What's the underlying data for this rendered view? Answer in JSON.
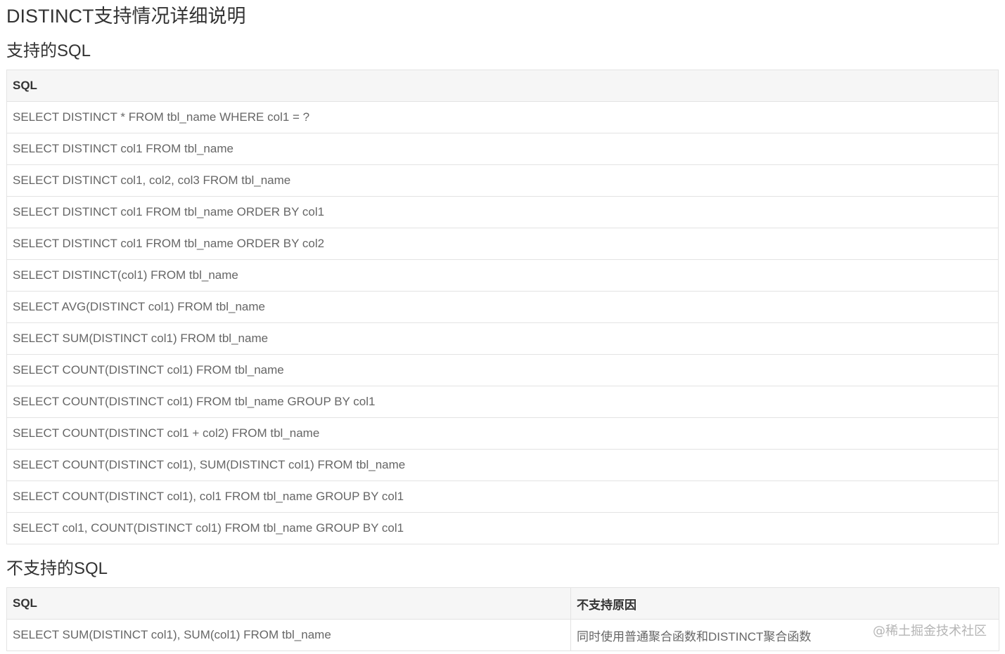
{
  "page": {
    "title": "DISTINCT支持情况详细说明"
  },
  "supported": {
    "heading": "支持的SQL",
    "column_header": "SQL",
    "rows": [
      "SELECT DISTINCT * FROM tbl_name WHERE col1 = ?",
      "SELECT DISTINCT col1 FROM tbl_name",
      "SELECT DISTINCT col1, col2, col3 FROM tbl_name",
      "SELECT DISTINCT col1 FROM tbl_name ORDER BY col1",
      "SELECT DISTINCT col1 FROM tbl_name ORDER BY col2",
      "SELECT DISTINCT(col1) FROM tbl_name",
      "SELECT AVG(DISTINCT col1) FROM tbl_name",
      "SELECT SUM(DISTINCT col1) FROM tbl_name",
      "SELECT COUNT(DISTINCT col1) FROM tbl_name",
      "SELECT COUNT(DISTINCT col1) FROM tbl_name GROUP BY col1",
      "SELECT COUNT(DISTINCT col1 + col2) FROM tbl_name",
      "SELECT COUNT(DISTINCT col1), SUM(DISTINCT col1) FROM tbl_name",
      "SELECT COUNT(DISTINCT col1), col1 FROM tbl_name GROUP BY col1",
      "SELECT col1, COUNT(DISTINCT col1) FROM tbl_name GROUP BY col1"
    ]
  },
  "unsupported": {
    "heading": "不支持的SQL",
    "column_headers": [
      "SQL",
      "不支持原因"
    ],
    "rows": [
      {
        "sql": "SELECT SUM(DISTINCT col1), SUM(col1) FROM tbl_name",
        "reason": "同时使用普通聚合函数和DISTINCT聚合函数"
      }
    ]
  },
  "watermark": "@稀土掘金技术社区"
}
